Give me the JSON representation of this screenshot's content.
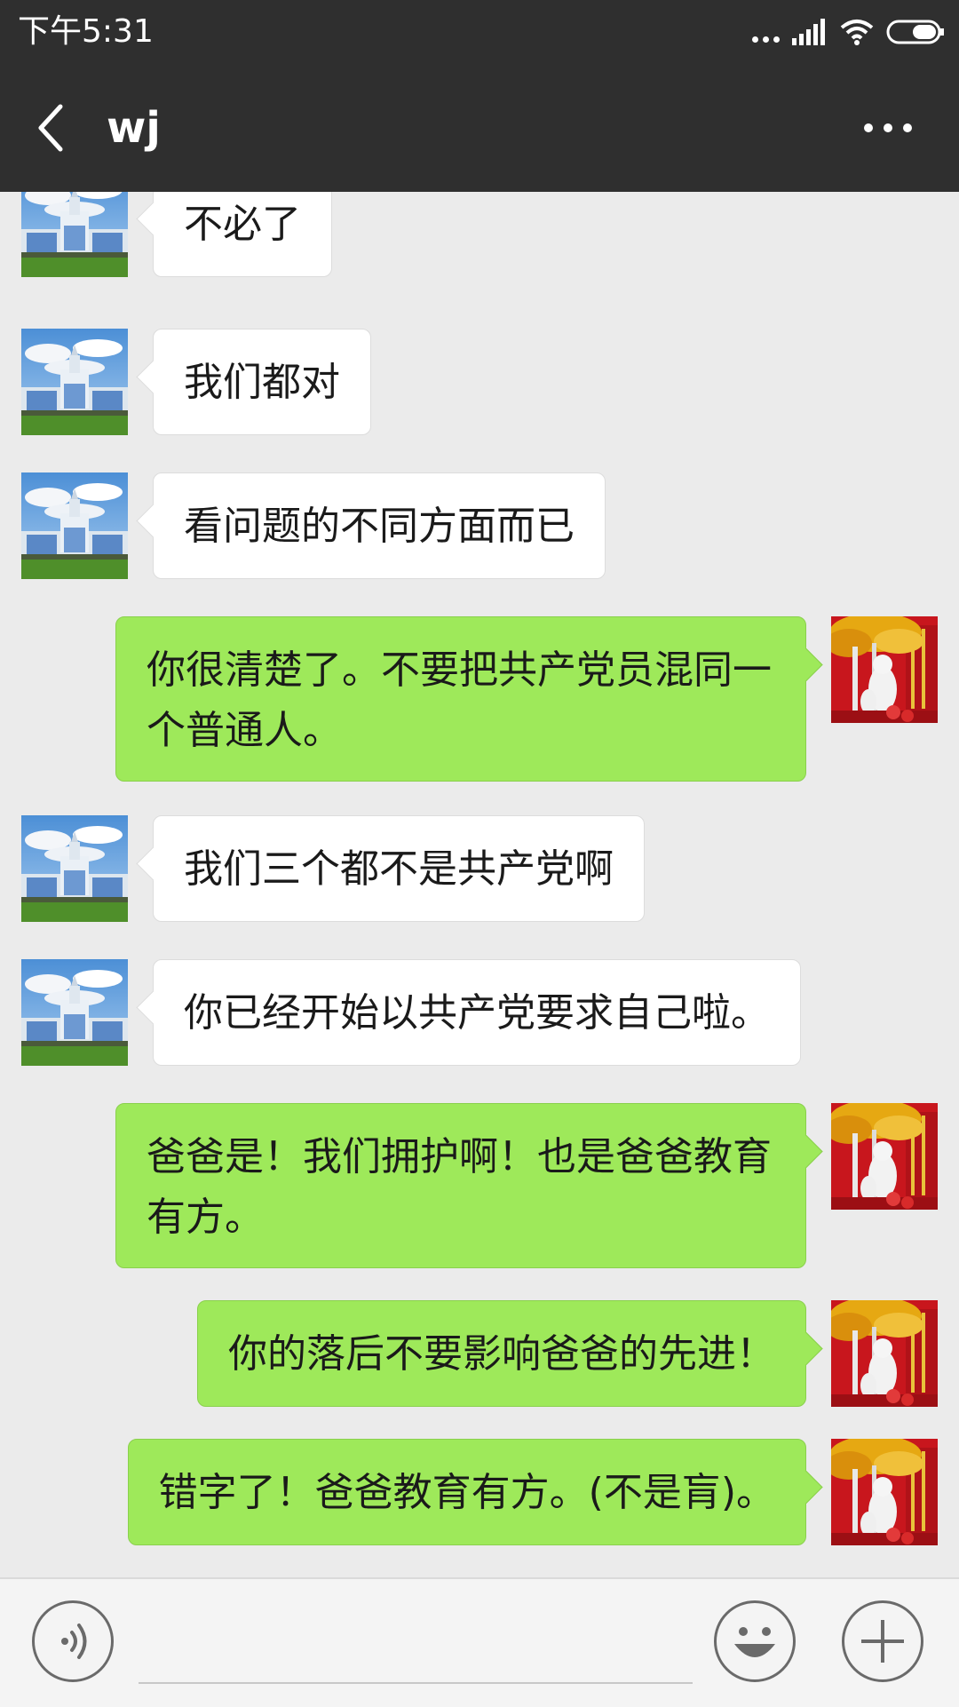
{
  "status_bar": {
    "time": "下午5:31",
    "icons": [
      "more-dots-icon",
      "signal-icon",
      "wifi-icon",
      "battery-icon"
    ]
  },
  "header": {
    "back_icon": "chevron-left-icon",
    "title": "wj",
    "more_icon": "more-horizontal-icon"
  },
  "messages": [
    {
      "side": "in",
      "text": "不必了"
    },
    {
      "side": "in",
      "text": "我们都对"
    },
    {
      "side": "in",
      "text": "看问题的不同方面而已"
    },
    {
      "side": "out",
      "text": "你很清楚了。不要把共产党员混同一个普通人。"
    },
    {
      "side": "in",
      "text": "我们三个都不是共产党啊"
    },
    {
      "side": "in",
      "text": "你已经开始以共产党要求自己啦。"
    },
    {
      "side": "out",
      "text": "爸爸是！我们拥护啊！也是爸爸教育有方。"
    },
    {
      "side": "out",
      "text": "你的落后不要影响爸爸的先进！"
    },
    {
      "side": "out",
      "text": "错字了！爸爸教育有方。(不是肓)。"
    }
  ],
  "input_bar": {
    "voice_icon": "voice-icon",
    "emoji_icon": "smiley-icon",
    "plus_icon": "plus-icon"
  },
  "colors": {
    "bar": "#2f2f2f",
    "chat_bg": "#ebebeb",
    "incoming_bubble": "#ffffff",
    "outgoing_bubble": "#9ee95a"
  }
}
